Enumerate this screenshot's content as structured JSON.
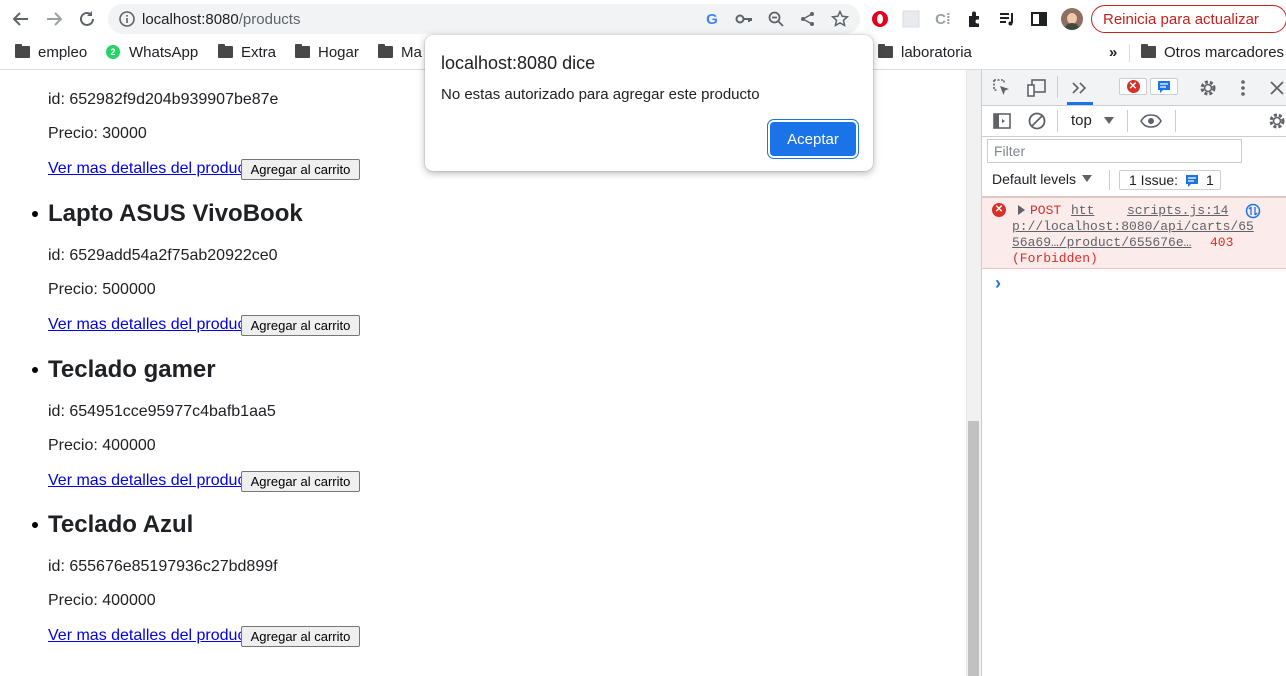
{
  "browser": {
    "url_host": "localhost:8080",
    "url_path": "/products",
    "restart_label": "Reinicia para actualizar"
  },
  "bookmarks": [
    {
      "label": "empleo",
      "icon": "folder-icon"
    },
    {
      "label": "WhatsApp",
      "icon": "whatsapp-icon"
    },
    {
      "label": "Extra",
      "icon": "folder-icon"
    },
    {
      "label": "Hogar",
      "icon": "folder-icon"
    },
    {
      "label": "Ma",
      "icon": "folder-icon"
    },
    {
      "label": "laboratoria",
      "icon": "folder-icon"
    },
    {
      "label": "»",
      "icon": ""
    },
    {
      "label": "Otros marcadores",
      "icon": "folder-icon"
    }
  ],
  "products": [
    {
      "title": "",
      "id": "id: 652982f9d204b939907be87e",
      "price": "Precio: 30000"
    },
    {
      "title": "Lapto ASUS VivoBook",
      "id": "id: 6529add54a2f75ab20922ce0",
      "price": "Precio: 500000"
    },
    {
      "title": "Teclado gamer",
      "id": "id: 654951cce95977c4bafb1aa5",
      "price": "Precio: 400000"
    },
    {
      "title": "Teclado Azul",
      "id": "id: 655676e85197936c27bd899f",
      "price": "Precio: 400000"
    }
  ],
  "product_actions": {
    "details_link": "Ver mas detalles del producto",
    "add_to_cart": "Agregar al carrito"
  },
  "dialog": {
    "title": "localhost:8080 dice",
    "message": "No estas autorizado para agregar este producto",
    "ok_label": "Aceptar"
  },
  "devtools": {
    "context": "top",
    "filter_placeholder": "Filter",
    "levels_label": "Default levels",
    "issues_label": "1 Issue:",
    "issues_count": "1",
    "error": {
      "method": "POST",
      "url_part1": "htt",
      "source": "scripts.js:14",
      "url_part2": "p://localhost:8080/api/carts/65",
      "url_part3": "56a69…/product/655676e…",
      "status": "403",
      "status_text": "(Forbidden)"
    },
    "prompt": "›"
  },
  "colors": {
    "link": "#0000ee",
    "accent": "#1a73e8",
    "error": "#d93025",
    "restart": "#c5221f"
  }
}
